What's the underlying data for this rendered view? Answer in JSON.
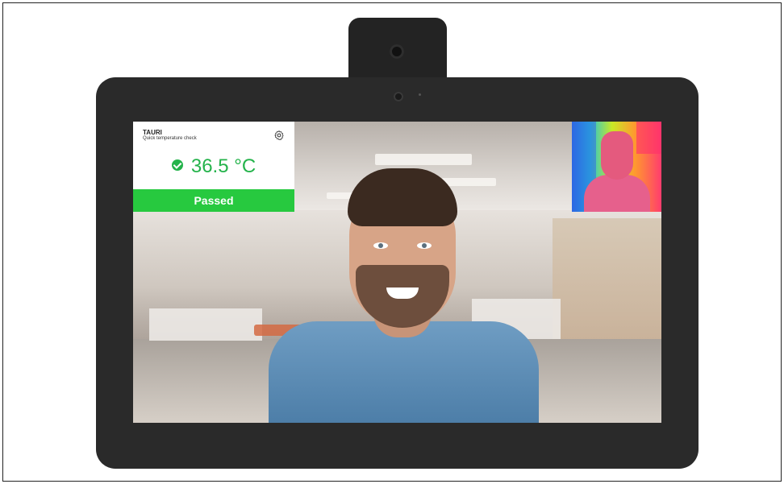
{
  "app": {
    "brand": "TAURI",
    "subtitle": "Quick temperature check"
  },
  "reading": {
    "temperature": "36.5 °C",
    "status": "Passed"
  },
  "colors": {
    "accent_green": "#24b34b",
    "status_green": "#27c93f",
    "device_body": "#2a2a2a"
  },
  "icons": {
    "settings": "gear-icon",
    "status": "check-circle-icon"
  }
}
